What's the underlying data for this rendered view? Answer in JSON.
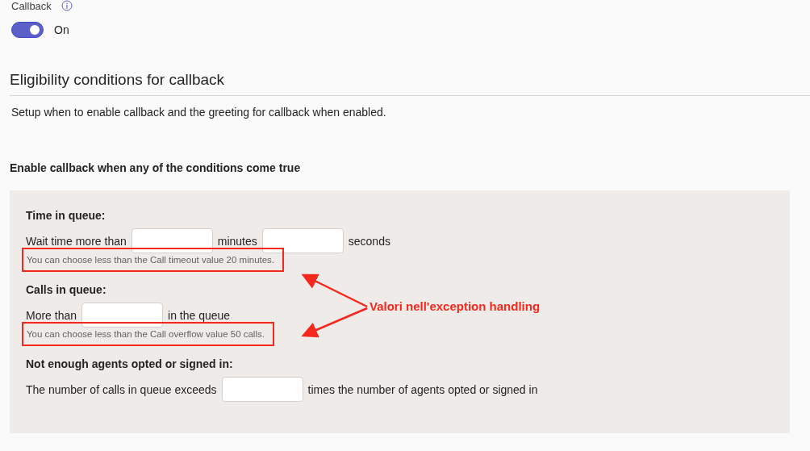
{
  "callback": {
    "label": "Callback",
    "toggle": {
      "on": true,
      "label": "On"
    }
  },
  "section": {
    "title": "Eligibility conditions for callback",
    "description": "Setup when to enable callback and the greeting for callback when enabled."
  },
  "conditions_heading": "Enable callback when any of the conditions come true",
  "conditions": [
    {
      "title": "Time in queue:",
      "parts": [
        {
          "kind": "text",
          "text": "Wait time more than"
        },
        {
          "kind": "input"
        },
        {
          "kind": "text",
          "text": "minutes"
        },
        {
          "kind": "input"
        },
        {
          "kind": "text",
          "text": "seconds"
        }
      ],
      "hint": {
        "text": "You can choose less than the Call timeout value 20 minutes.",
        "highlighted": true
      }
    },
    {
      "title": "Calls in queue:",
      "parts": [
        {
          "kind": "text",
          "text": "More than"
        },
        {
          "kind": "input"
        },
        {
          "kind": "text",
          "text": "in the queue"
        }
      ],
      "hint": {
        "text": "You can choose less than the Call overflow value 50 calls.",
        "highlighted": true
      }
    },
    {
      "title": "Not enough agents opted or signed in:",
      "parts": [
        {
          "kind": "text",
          "text": "The number of calls in queue exceeds"
        },
        {
          "kind": "input"
        },
        {
          "kind": "text",
          "text": "times the number of agents opted or signed in"
        }
      ]
    }
  ],
  "annotation": {
    "text": "Valori nell'exception handling"
  }
}
